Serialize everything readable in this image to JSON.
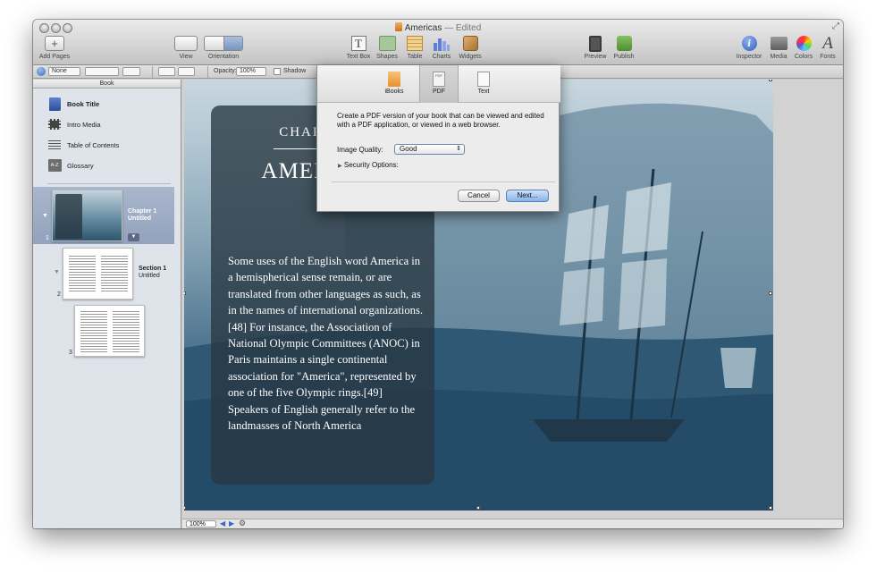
{
  "window": {
    "title": "Americas",
    "status": "— Edited"
  },
  "toolbar": {
    "add_pages": "Add Pages",
    "view": "View",
    "orientation": "Orientation",
    "text_box": "Text Box",
    "shapes": "Shapes",
    "table": "Table",
    "charts": "Charts",
    "widgets": "Widgets",
    "preview": "Preview",
    "publish": "Publish",
    "inspector": "Inspector",
    "media": "Media",
    "colors": "Colors",
    "fonts": "Fonts",
    "fonts_glyph": "A"
  },
  "format_bar": {
    "style": "None",
    "opacity_label": "Opacity:",
    "opacity_value": "100%",
    "shadow_label": "Shadow"
  },
  "sidebar": {
    "header": "Book",
    "items": [
      {
        "label": "Book Title",
        "icon": "book-icon"
      },
      {
        "label": "Intro Media",
        "icon": "film-icon"
      },
      {
        "label": "Table of Contents",
        "icon": "list-icon"
      },
      {
        "label": "Glossary",
        "icon": "glossary-icon",
        "icon_text": "A-Z"
      }
    ],
    "chapter": {
      "page": "1",
      "title": "Chapter 1",
      "subtitle": "Untitled"
    },
    "section": {
      "page": "2",
      "title": "Section 1",
      "subtitle": "Untitled"
    },
    "page3": {
      "page": "3"
    }
  },
  "page": {
    "chapter_label": "CHAPTER 1",
    "title": "AMERICAS",
    "body": "Some uses of the English word America in a hemispherical sense remain, or are translated from other languages as such, as in the names of international organizations.[48] For instance, the Association of National Olympic Committees (ANOC) in Paris maintains a single continental association for \"America\", represented by one of the five Olympic rings.[49] Speakers of English generally refer to the landmasses of North America"
  },
  "statusbar": {
    "zoom": "100%"
  },
  "export": {
    "tabs": [
      {
        "label": "iBooks"
      },
      {
        "label": "PDF"
      },
      {
        "label": "Text"
      }
    ],
    "active_tab": "PDF",
    "pdf_icon_text": "PDF",
    "description": "Create a PDF version of your book that can be viewed and edited with a PDF application, or viewed in a web browser.",
    "image_quality_label": "Image Quality:",
    "image_quality_value": "Good",
    "security_options": "Security Options:",
    "cancel": "Cancel",
    "next": "Next..."
  },
  "colors": {
    "selection": "#93a2bd",
    "primary_button": "#86b4ea",
    "caption_panel": "#283741"
  }
}
